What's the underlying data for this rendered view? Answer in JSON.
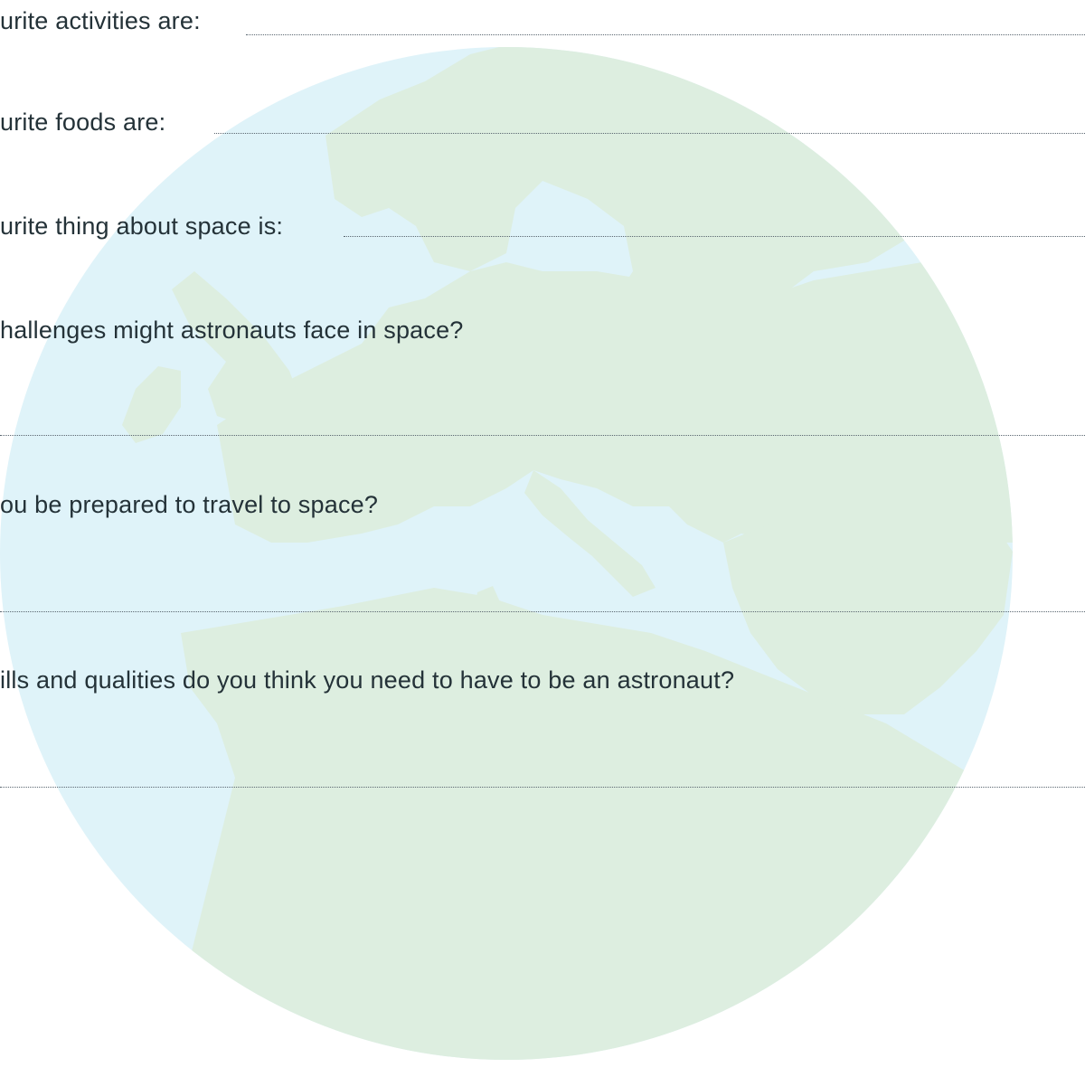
{
  "worksheet": {
    "fields": [
      {
        "label": "urite activities are:"
      },
      {
        "label": "urite foods are:"
      },
      {
        "label": "urite thing about space is:"
      }
    ],
    "questions": [
      {
        "text": "hallenges might astronauts face in space?"
      },
      {
        "text": "ou be prepared to travel to space?"
      },
      {
        "text": "ills and qualities do you think you need to have to be an astronaut?"
      }
    ]
  },
  "colors": {
    "ocean": "#dff3f9",
    "land": "#ddeee0",
    "text": "#243238",
    "dotted_line": "#5a6670"
  }
}
